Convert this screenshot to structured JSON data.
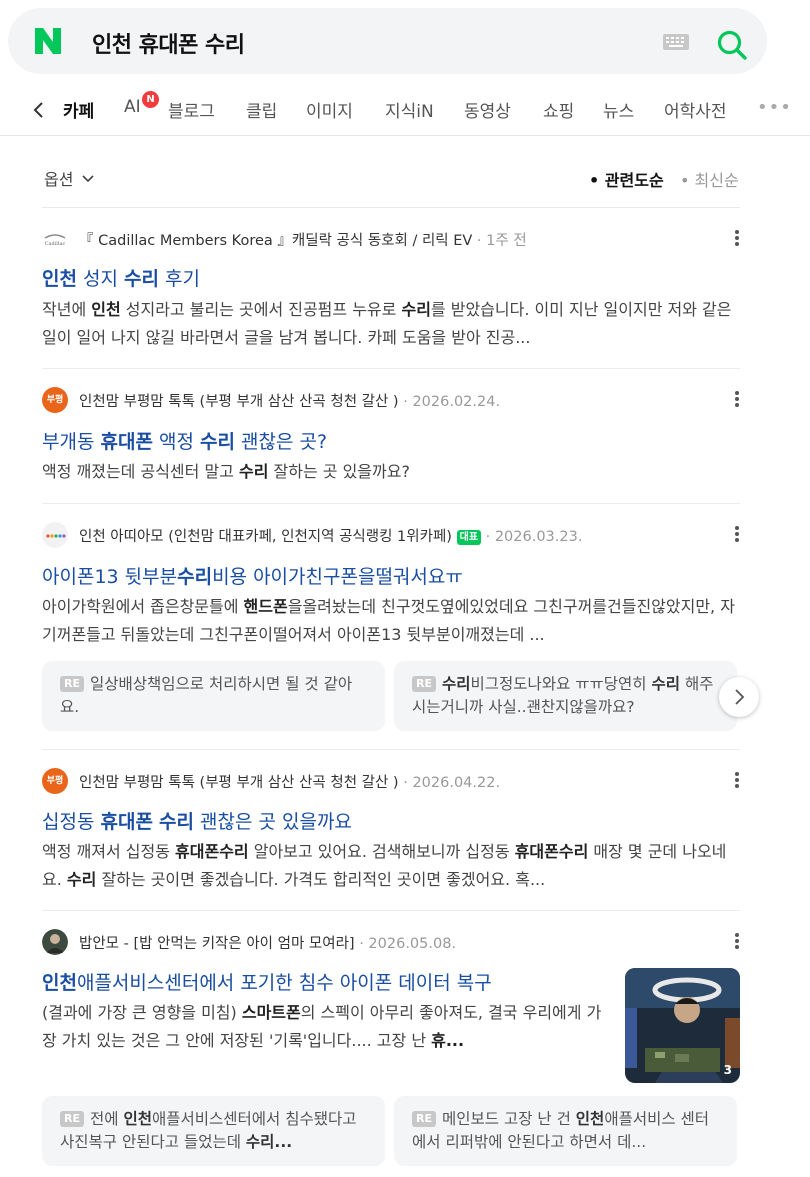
{
  "search": {
    "query": "인천 휴대폰 수리",
    "logo_letter": "N",
    "brand_color": "#03c75a"
  },
  "tabs": [
    {
      "label": "카페",
      "active": true
    },
    {
      "label": "AI",
      "badge": "N"
    },
    {
      "label": "블로그"
    },
    {
      "label": "클립"
    },
    {
      "label": "이미지"
    },
    {
      "label": "지식iN"
    },
    {
      "label": "동영상"
    },
    {
      "label": "쇼핑"
    },
    {
      "label": "뉴스"
    },
    {
      "label": "어학사전"
    }
  ],
  "more_label": "•••",
  "options_label": "옵션",
  "sort": {
    "relevance": "관련도순",
    "recent": "최신순"
  },
  "results": [
    {
      "source": "『 Cadillac Members Korea 』캐딜락 공식 동호회 / 리릭 EV",
      "date": "1주 전",
      "title_parts": [
        {
          "t": "인천",
          "b": true
        },
        {
          "t": " 성지 "
        },
        {
          "t": "수리",
          "b": true
        },
        {
          "t": " 후기"
        }
      ],
      "desc_parts": [
        {
          "t": "작년에 "
        },
        {
          "t": "인천",
          "b": true
        },
        {
          "t": " 성지라고 불리는 곳에서 진공펌프 누유로 "
        },
        {
          "t": "수리",
          "b": true
        },
        {
          "t": "를 받았습니다. 이미 지난 일이지만 저와 같은 일이 일어 나지 않길 바라면서 글을 남겨 봅니다. 카페 도움을 받아 진공..."
        }
      ]
    },
    {
      "source": "인천맘 부평맘 톡톡 (부평 부개 삼산 산곡 청천 갈산 )",
      "date": "2026.02.24.",
      "avatar_text": "부평",
      "title_parts": [
        {
          "t": "부개동 "
        },
        {
          "t": "휴대폰",
          "b": true
        },
        {
          "t": " 액정 "
        },
        {
          "t": "수리",
          "b": true
        },
        {
          "t": " 괜찮은 곳?"
        }
      ],
      "desc_parts": [
        {
          "t": "액정 깨졌는데 공식센터 말고 "
        },
        {
          "t": "수리",
          "b": true
        },
        {
          "t": " 잘하는 곳 있을까요?"
        }
      ]
    },
    {
      "source": "인천 아띠아모 (인천맘 대표카페, 인천지역 공식랭킹 1위카페)",
      "badge": "대표",
      "date": "2026.03.23.",
      "title_parts": [
        {
          "t": "아이폰13 뒷부분"
        },
        {
          "t": "수리",
          "b": true
        },
        {
          "t": "비용 아이가친구폰을떨궈서요ㅠ"
        }
      ],
      "desc_parts": [
        {
          "t": "아이가학원에서 좁은창문틀에 "
        },
        {
          "t": "핸드폰",
          "b": true
        },
        {
          "t": "을올려놨는데 친구껏도옆에있었데요 그친구꺼를건들진않았지만, 자기꺼폰들고 뒤돌았는데 그친구폰이떨어져서 아이폰13 뒷부분이깨졌는데 ..."
        }
      ],
      "replies": [
        [
          {
            "t": "일상배상책임으로 처리하시면 될 것 같아요."
          }
        ],
        [
          {
            "t": "수리",
            "b": true
          },
          {
            "t": "비그정도나와요 ㅠㅠ당연히 "
          },
          {
            "t": "수리",
            "b": true
          },
          {
            "t": " 해주시는거니까 사실..괜찬지않을까요?"
          }
        ]
      ]
    },
    {
      "source": "인천맘 부평맘 톡톡 (부평 부개 삼산 산곡 청천 갈산 )",
      "date": "2026.04.22.",
      "avatar_text": "부평",
      "title_parts": [
        {
          "t": "십정동 "
        },
        {
          "t": "휴대폰",
          "b": true
        },
        {
          "t": " "
        },
        {
          "t": "수리",
          "b": true
        },
        {
          "t": " 괜찮은 곳 있을까요"
        }
      ],
      "desc_parts": [
        {
          "t": "액정 깨져서 십정동 "
        },
        {
          "t": "휴대폰수리",
          "b": true
        },
        {
          "t": " 알아보고 있어요. 검색해보니까 십정동 "
        },
        {
          "t": "휴대폰수리",
          "b": true
        },
        {
          "t": " 매장 몇 군데 나오네요. "
        },
        {
          "t": "수리",
          "b": true
        },
        {
          "t": " 잘하는 곳이면 좋겠습니다. 가격도 합리적인 곳이면 좋겠어요. 혹..."
        }
      ]
    },
    {
      "source": "밥안모 - [밥 안먹는 키작은 아이 엄마 모여라]",
      "date": "2026.05.08.",
      "title_parts": [
        {
          "t": "인천",
          "b": true
        },
        {
          "t": "애플서비스센터에서 포기한 침수 아이폰 데이터 복구"
        }
      ],
      "desc_parts": [
        {
          "t": "(결과에 가장 큰 영향을 미침) "
        },
        {
          "t": "스마트폰",
          "b": true
        },
        {
          "t": "의 스펙이 아무리 좋아져도, 결국 우리에게 가장 가치 있는 것은 그 안에 저장된 '기록'입니다.... 고장 난 "
        },
        {
          "t": "휴...",
          "b": true
        }
      ],
      "thumb_count": "3",
      "replies": [
        [
          {
            "t": "전에 "
          },
          {
            "t": "인천",
            "b": true
          },
          {
            "t": "애플서비스센터에서 침수됐다고 사진복구 안된다고 들었는데 "
          },
          {
            "t": "수리...",
            "b": true
          }
        ],
        [
          {
            "t": "메인보드 고장 난 건 "
          },
          {
            "t": "인천",
            "b": true
          },
          {
            "t": "애플서비스 센터에서 리퍼밖에 안된다고 하면서 데..."
          }
        ]
      ]
    }
  ],
  "re_label": "RE"
}
